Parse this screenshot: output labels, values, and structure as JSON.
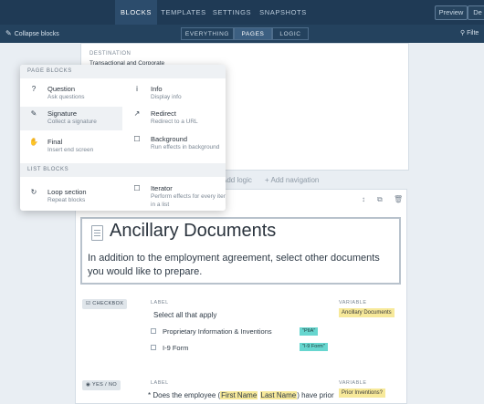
{
  "topnav": {
    "tabs": [
      "BLOCKS",
      "TEMPLATES",
      "SETTINGS",
      "SNAPSHOTS"
    ],
    "preview_label": "Preview",
    "deploy_label": "De"
  },
  "subbar": {
    "collapse_label": "Collapse blocks",
    "segments": [
      "EVERYTHING",
      "PAGES",
      "LOGIC"
    ],
    "filter_label": "Filte"
  },
  "destination": {
    "label": "DESTINATION",
    "value": "Transactional and Corporate"
  },
  "add_row": {
    "logic": "Add logic",
    "navigation": "+ Add navigation"
  },
  "block": {
    "title": "Ancillary Documents",
    "description": "In addition to the employment agreement, select other documents you would like to prepare.",
    "q1": {
      "type": "CHECKBOX",
      "label_header": "LABEL",
      "variable_header": "VARIABLE",
      "question": "Select all that apply",
      "variable": "Ancillary Documents",
      "options": [
        {
          "label": "Proprietary Information & Inventions",
          "var": "\"PIIA\""
        },
        {
          "label": "I-9 Form",
          "var": "\"I-9 Form\""
        }
      ]
    },
    "q2": {
      "type": "YES / NO",
      "label_header": "LABEL",
      "variable_header": "VARIABLE",
      "prefix": "* Does the employee (",
      "var_first": "First Name",
      "var_last": "Last Name",
      "suffix": ") have prior",
      "variable": "Prior Inventions?"
    }
  },
  "menu": {
    "page_blocks_header": "PAGE BLOCKS",
    "list_blocks_header": "LIST BLOCKS",
    "items": [
      {
        "icon": "?",
        "name": "Question",
        "sub": "Ask questions"
      },
      {
        "icon": "i",
        "name": "Info",
        "sub": "Display info"
      },
      {
        "icon": "✎",
        "name": "Signature",
        "sub": "Collect a signature"
      },
      {
        "icon": "↗",
        "name": "Redirect",
        "sub": "Redirect to a URL"
      },
      {
        "icon": "✋",
        "name": "Final",
        "sub": "Insert end screen"
      },
      {
        "icon": "☐",
        "name": "Background",
        "sub": "Run effects in background"
      },
      {
        "icon": "↻",
        "name": "Loop section",
        "sub": "Repeat blocks"
      },
      {
        "icon": "☐",
        "name": "Iterator",
        "sub": "Perform effects for every item in a list"
      }
    ]
  }
}
